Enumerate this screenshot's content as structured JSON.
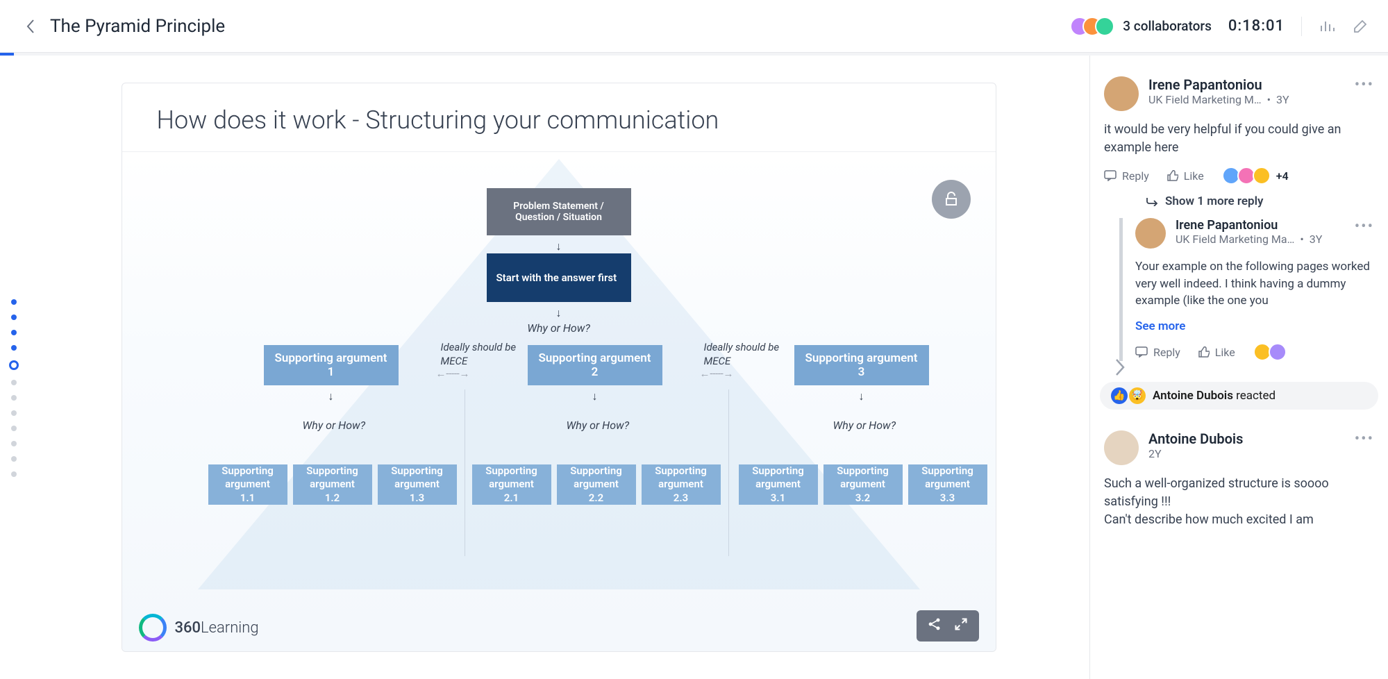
{
  "header": {
    "title": "The Pyramid Principle",
    "collaborators": "3 collaborators",
    "timer": "0:18:01"
  },
  "progress": {
    "percent": 1
  },
  "dots": {
    "total": 12,
    "active": [
      0,
      1,
      2,
      3
    ],
    "current": 4
  },
  "slide": {
    "title": "How does it work - Structuring your communication",
    "box_top": "Problem Statement / Question / Situation",
    "box_answer": "Start with the answer first",
    "why_how": "Why or How?",
    "mece": "Ideally should be MECE",
    "mid": [
      "Supporting argument 1",
      "Supporting argument 2",
      "Supporting argument 3"
    ],
    "leaf": [
      "Supporting argument 1.1",
      "Supporting argument 1.2",
      "Supporting argument 1.3",
      "Supporting argument 2.1",
      "Supporting argument 2.2",
      "Supporting argument 2.3",
      "Supporting argument 3.1",
      "Supporting argument 3.2",
      "Supporting argument 3.3"
    ],
    "brand": "360",
    "brand2": "Learning"
  },
  "comments": {
    "c1": {
      "name": "Irene Papantoniou",
      "role": "UK Field Marketing M…",
      "time": "3Y",
      "body": "it would be very helpful if you could give an example here",
      "reply": "Reply",
      "like": "Like",
      "plus": "+4",
      "show_more": "Show 1 more reply"
    },
    "c1r": {
      "name": "Irene Papantoniou",
      "role": "UK Field Marketing Ma…",
      "time": "3Y",
      "body": "Your example on the following pages worked very well indeed. I think having a dummy example (like the one you",
      "see_more": "See more",
      "reply": "Reply",
      "like": "Like"
    },
    "reaction": {
      "name": "Antoine Dubois",
      "suffix": " reacted"
    },
    "c2": {
      "name": "Antoine Dubois",
      "time": "2Y",
      "body": "Such a well-organized structure is soooo satisfying !!!\nCan't describe how much excited I am"
    }
  }
}
